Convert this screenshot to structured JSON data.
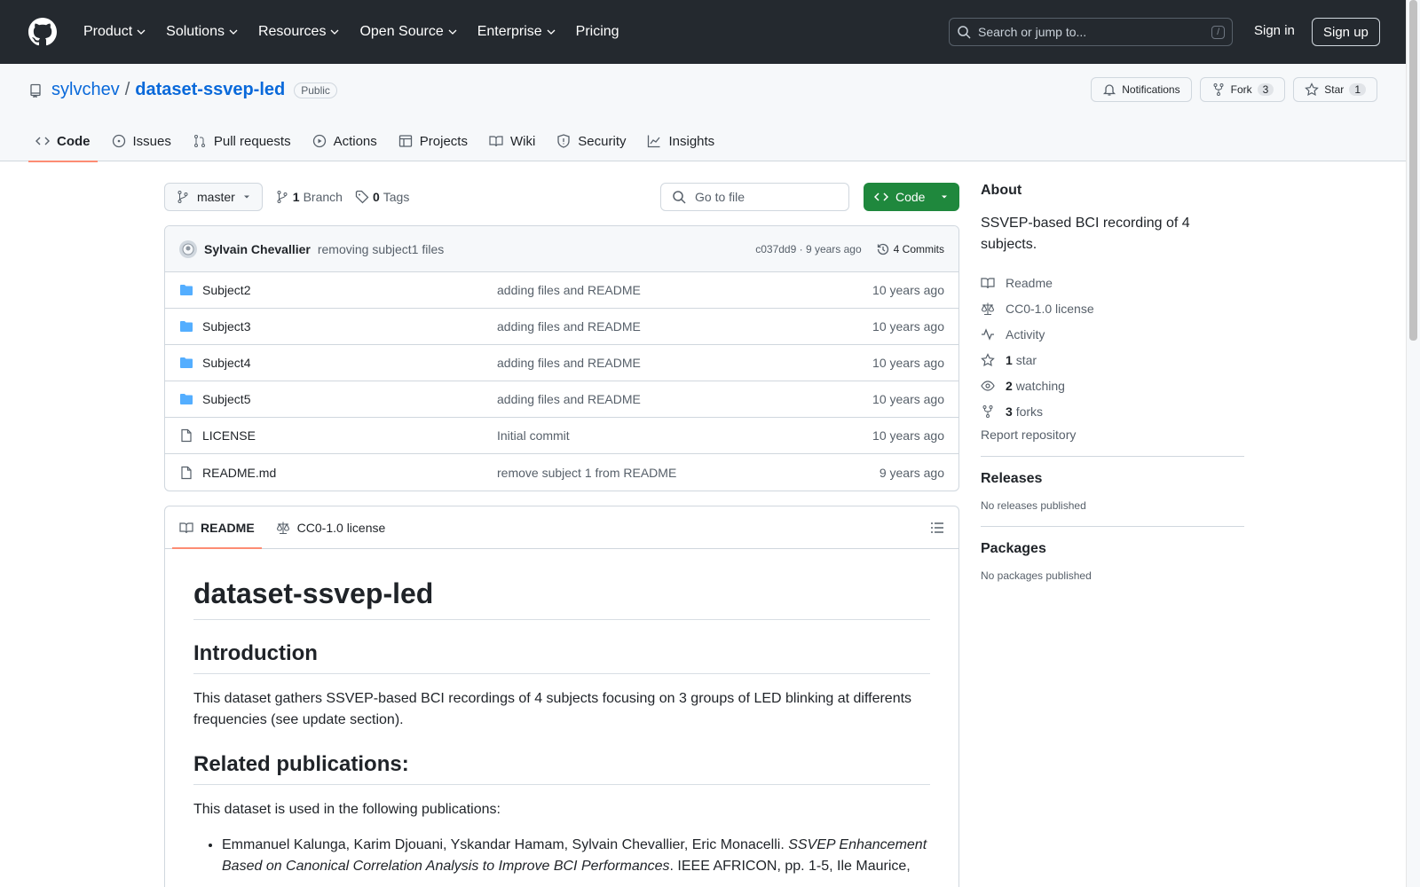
{
  "header": {
    "nav": [
      "Product",
      "Solutions",
      "Resources",
      "Open Source",
      "Enterprise"
    ],
    "pricing": "Pricing",
    "search_placeholder": "Search or jump to...",
    "search_key": "/",
    "signin": "Sign in",
    "signup": "Sign up"
  },
  "repo": {
    "owner": "sylvchev",
    "separator": "/",
    "name": "dataset-ssvep-led",
    "visibility": "Public",
    "notifications": "Notifications",
    "fork_label": "Fork",
    "fork_count": "3",
    "star_label": "Star",
    "star_count": "1",
    "tabs": [
      "Code",
      "Issues",
      "Pull requests",
      "Actions",
      "Projects",
      "Wiki",
      "Security",
      "Insights"
    ]
  },
  "toolbar": {
    "branch": "master",
    "branch_count": "1",
    "branch_label": "Branch",
    "tag_count": "0",
    "tag_label": "Tags",
    "goto_placeholder": "Go to file",
    "code_label": "Code"
  },
  "commit": {
    "author": "Sylvain Chevallier",
    "message": "removing subject1 files",
    "sha_time": "c037dd9 · 9 years ago",
    "commits": "4 Commits"
  },
  "files": [
    {
      "name": "Subject2",
      "type": "dir",
      "message": "adding files and README",
      "date": "10 years ago"
    },
    {
      "name": "Subject3",
      "type": "dir",
      "message": "adding files and README",
      "date": "10 years ago"
    },
    {
      "name": "Subject4",
      "type": "dir",
      "message": "adding files and README",
      "date": "10 years ago"
    },
    {
      "name": "Subject5",
      "type": "dir",
      "message": "adding files and README",
      "date": "10 years ago"
    },
    {
      "name": "LICENSE",
      "type": "file",
      "message": "Initial commit",
      "date": "10 years ago"
    },
    {
      "name": "README.md",
      "type": "file",
      "message": "remove subject 1 from README",
      "date": "9 years ago"
    }
  ],
  "readme": {
    "tab_readme": "README",
    "tab_license": "CC0-1.0 license",
    "title": "dataset-ssvep-led",
    "intro_heading": "Introduction",
    "intro_text": "This dataset gathers SSVEP-based BCI recordings of 4 subjects focusing on 3 groups of LED blinking at differents frequencies (see update section).",
    "pubs_heading": "Related publications:",
    "pubs_text": "This dataset is used in the following publications:",
    "pub1_authors": "Emmanuel Kalunga, Karim Djouani, Yskandar Hamam, Sylvain Chevallier, Eric Monacelli. ",
    "pub1_title": "SSVEP Enhancement Based on Canonical Correlation Analysis to Improve BCI Performances",
    "pub1_rest": ". IEEE AFRICON, pp. 1-5, Ile Maurice,"
  },
  "about": {
    "heading": "About",
    "description": "SSVEP-based BCI recording of 4 subjects.",
    "readme": "Readme",
    "license": "CC0-1.0 license",
    "activity": "Activity",
    "stars_count": "1",
    "stars_label": "star",
    "watching_count": "2",
    "watching_label": "watching",
    "forks_count": "3",
    "forks_label": "forks",
    "report": "Report repository"
  },
  "releases": {
    "heading": "Releases",
    "text": "No releases published"
  },
  "packages": {
    "heading": "Packages",
    "text": "No packages published"
  }
}
